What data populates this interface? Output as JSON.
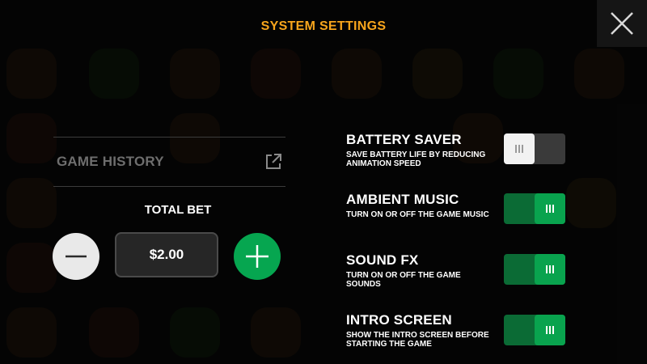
{
  "header": {
    "title": "SYSTEM SETTINGS",
    "title_color": "#f7a51c"
  },
  "close_icon": "close-x-icon",
  "game_history": {
    "label": "GAME HISTORY",
    "icon": "external-link-icon"
  },
  "bet": {
    "label": "TOTAL BET",
    "value": "$2.00",
    "minus_icon": "minus-icon",
    "plus_icon": "plus-icon",
    "plus_color": "#06a650"
  },
  "settings": [
    {
      "title": "BATTERY SAVER",
      "description": "SAVE BATTERY LIFE BY REDUCING ANIMATION SPEED",
      "enabled": false
    },
    {
      "title": "AMBIENT MUSIC",
      "description": "TURN ON OR OFF THE GAME MUSIC",
      "enabled": true
    },
    {
      "title": "SOUND FX",
      "description": "TURN ON OR OFF THE GAME SOUNDS",
      "enabled": true
    },
    {
      "title": "INTRO SCREEN",
      "description": "SHOW THE INTRO SCREEN BEFORE STARTING THE GAME",
      "enabled": true
    }
  ],
  "colors": {
    "toggle_on": "#09a34e",
    "toggle_off": "#3a3a3a"
  }
}
